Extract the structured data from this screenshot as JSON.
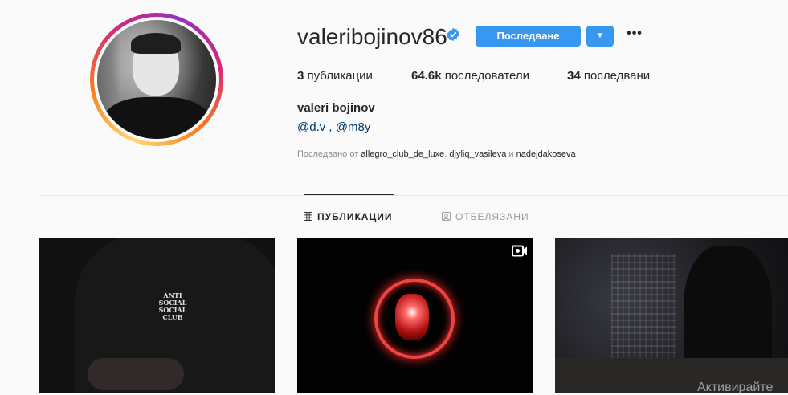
{
  "profile": {
    "username": "valeribojinov86",
    "verified": true,
    "follow_label": "Последване",
    "dropdown_glyph": "▼",
    "more_glyph": "•••",
    "full_name": "valeri bojinov",
    "bio_mention_1": "@d.v",
    "bio_separator": " , ",
    "bio_mention_2": "@m8y"
  },
  "stats": {
    "posts_count": "3",
    "posts_label": "публикации",
    "followers_count": "64.6k",
    "followers_label": "последователи",
    "following_count": "34",
    "following_label": "последвани"
  },
  "followed_by": {
    "prefix": "Последвано от ",
    "user_1": "allegro_club_de_luxe",
    "sep_1": ", ",
    "user_2": "djyliq_vasileva",
    "sep_2": " и ",
    "user_3": "nadejdakoseva"
  },
  "tabs": {
    "posts_label": "ПУБЛИКАЦИИ",
    "tagged_label": "ОТБЕЛЯЗАНИ"
  },
  "grid": {
    "tile_1_logo": [
      "ANTI",
      "SOCIAL",
      "SOCIAL",
      "CLUB"
    ]
  },
  "watermark": "Активирайте",
  "colors": {
    "accent": "#3897f0",
    "text": "#262626",
    "muted": "#8e8e8e",
    "background": "#fafafa"
  },
  "icons": {
    "verified": "verified-badge-icon",
    "grid": "grid-icon",
    "tagged": "tagged-icon",
    "video": "video-icon",
    "more": "more-options-icon"
  }
}
